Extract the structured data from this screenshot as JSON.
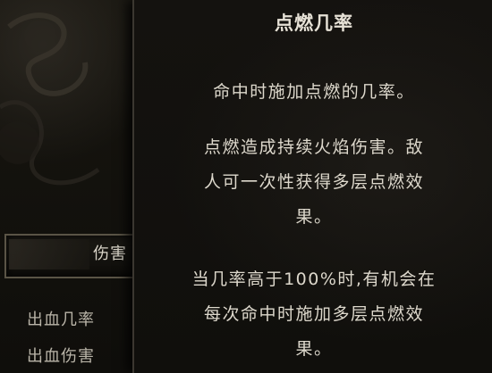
{
  "left_panel": {
    "tab_label": "伤害",
    "stats": [
      "出血几率",
      "出血伤害"
    ]
  },
  "tooltip": {
    "title": "点燃几率",
    "lines": [
      "命中时施加点燃的几率。",
      "点燃造成持续火焰伤害。敌",
      "人可一次性获得多层点燃效",
      "果。",
      "当几率高于100%时,有机会在",
      "每次命中时施加多层点燃效",
      "果。"
    ]
  }
}
